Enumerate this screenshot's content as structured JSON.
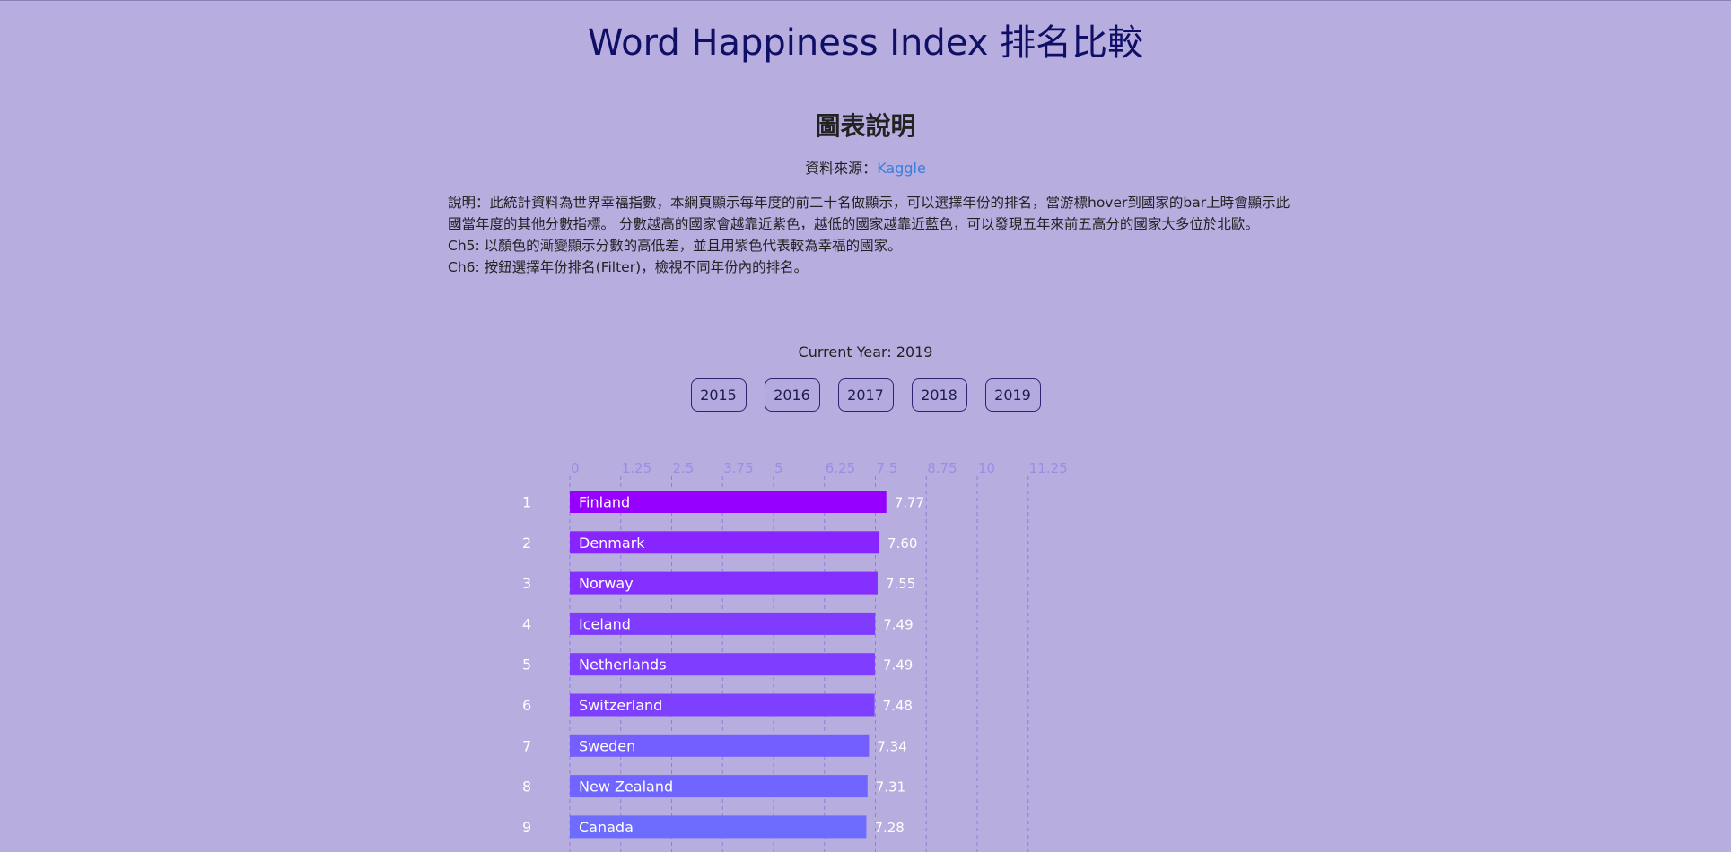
{
  "page": {
    "title": "Word Happiness Index 排名比較",
    "section_title": "圖表說明",
    "source_prefix": "資料來源：",
    "source_link": "Kaggle",
    "description": [
      "說明：此統計資料為世界幸福指數，本網頁顯示每年度的前二十名做顯示，可以選擇年份的排名，當游標hover到國家的bar上時會顯示此國當年度的其他分數指標。 分數越高的國家會越靠近紫色，越低的國家越靠近藍色，可以發現五年來前五高分的國家大多位於北歐。",
      "Ch5: 以顏色的漸變顯示分數的高低差，並且用紫色代表較為幸福的國家。",
      "Ch6: 按鈕選擇年份排名(Filter)，檢視不同年份內的排名。"
    ],
    "current_year_label": "Current Year: 2019"
  },
  "year_buttons": [
    "2015",
    "2016",
    "2017",
    "2018",
    "2019"
  ],
  "colors": {
    "background": "#b8addf",
    "title": "#0f0f66",
    "link": "#3b7ddd",
    "bar_high": "#9500ff",
    "bar_low": "#6e6cff",
    "grid": "#8f80d8",
    "tick": "#9d8ce6"
  },
  "chart_data": {
    "type": "bar",
    "orientation": "horizontal",
    "year": 2019,
    "ticks": [
      "0",
      "1.25",
      "2.5",
      "3.75",
      "5",
      "6.25",
      "7.5",
      "8.75",
      "10",
      "11.25"
    ],
    "xlim": [
      0,
      12
    ],
    "grid": true,
    "ranks": [
      "1",
      "2",
      "3",
      "4",
      "5",
      "6",
      "7",
      "8",
      "9"
    ],
    "categories": [
      "Finland",
      "Denmark",
      "Norway",
      "Iceland",
      "Netherlands",
      "Switzerland",
      "Sweden",
      "New Zealand",
      "Canada"
    ],
    "values": [
      7.769,
      7.6,
      7.554,
      7.494,
      7.488,
      7.48,
      7.343,
      7.307,
      7.278
    ],
    "value_labels": [
      "7.77",
      "7.60",
      "7.55",
      "7.49",
      "7.49",
      "7.48",
      "7.34",
      "7.31",
      "7.28"
    ]
  }
}
